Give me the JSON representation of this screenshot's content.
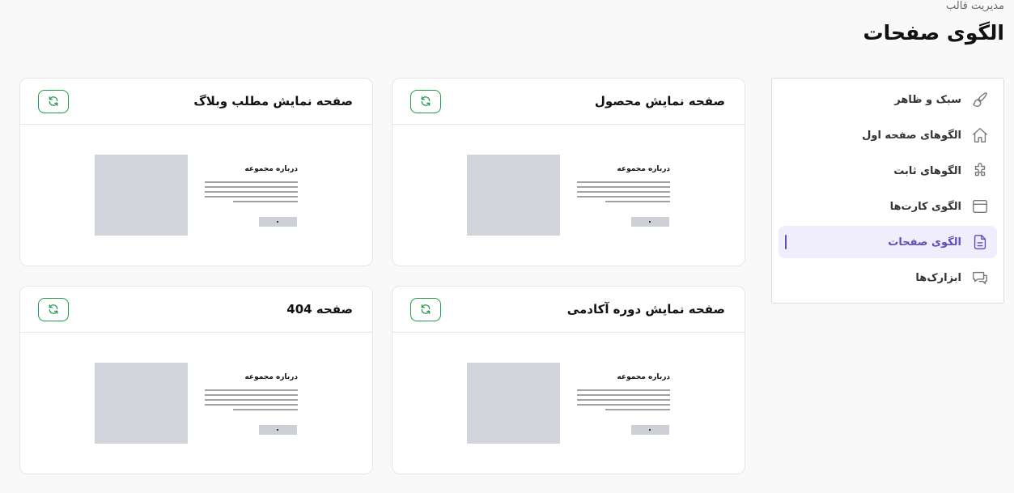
{
  "breadcrumb": "مدیریت قالب",
  "page_title": "الگوی صفحات",
  "sidebar": {
    "items": [
      {
        "label": "سبک و ظاهر",
        "icon": "brush-icon",
        "active": false
      },
      {
        "label": "الگوهای صفحه اول",
        "icon": "home-icon",
        "active": false
      },
      {
        "label": "الگوهای ثابت",
        "icon": "puzzle-icon",
        "active": false
      },
      {
        "label": "الگوی کارت‌ها",
        "icon": "browser-window-icon",
        "active": false
      },
      {
        "label": "الگوی صفحات",
        "icon": "document-icon",
        "active": true
      },
      {
        "label": "ابزارک‌ها",
        "icon": "chat-bubbles-icon",
        "active": false
      }
    ]
  },
  "cards": [
    {
      "title": "صفحه نمایش محصول",
      "preview_title": "درباره مجموعه"
    },
    {
      "title": "صفحه نمایش مطلب وبلاگ",
      "preview_title": "درباره مجموعه"
    },
    {
      "title": "صفحه نمایش دوره آکادمی",
      "preview_title": "درباره مجموعه"
    },
    {
      "title": "صفحه 404",
      "preview_title": "درباره مجموعه"
    }
  ],
  "colors": {
    "accent": "#5b4fb8",
    "refresh_green": "#1f9b4a",
    "placeholder_gray": "#d1d4da"
  }
}
